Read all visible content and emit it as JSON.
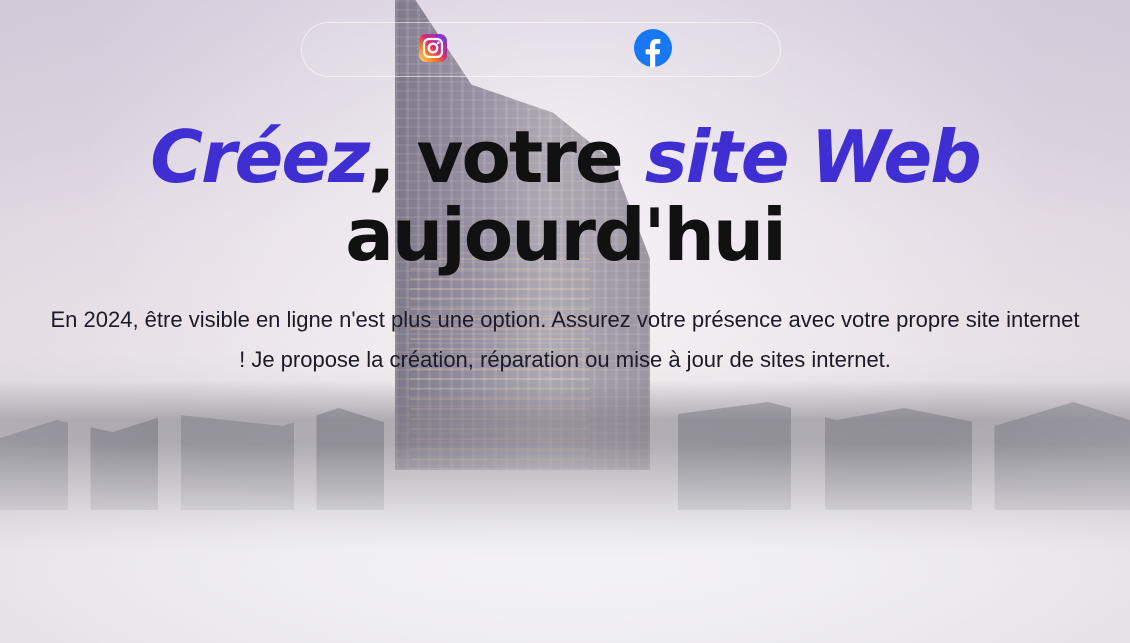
{
  "social": {
    "instagram_icon": "instagram-icon",
    "facebook_icon": "facebook-icon"
  },
  "hero": {
    "headline_part1": "Créez",
    "headline_part2": ", votre ",
    "headline_part3": "site Web",
    "headline_part4": "aujourd'hui",
    "subtext": "En 2024, être visible en ligne n'est plus une option. Assurez votre présence avec votre propre site internet ! Je propose la création, réparation ou mise à jour de sites internet."
  },
  "colors": {
    "accent": "#3f2ed1",
    "headline": "#111111",
    "facebook": "#1877f2"
  }
}
